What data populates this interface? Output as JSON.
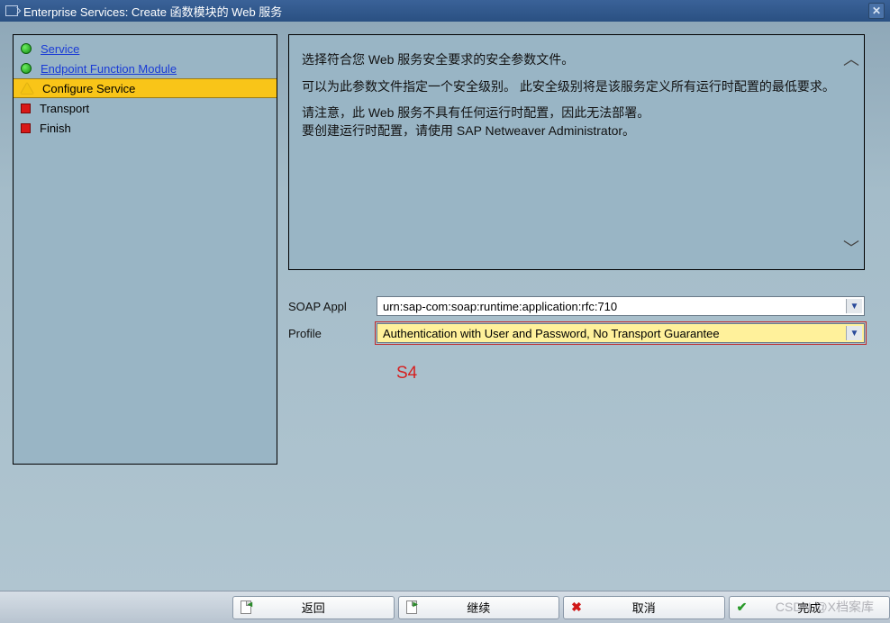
{
  "titlebar": {
    "title": "Enterprise Services: Create 函数模块的 Web 服务"
  },
  "steps": [
    {
      "label": "Service",
      "status": "done",
      "link": true
    },
    {
      "label": "Endpoint Function Module",
      "status": "done",
      "link": true
    },
    {
      "label": "Configure Service",
      "status": "current",
      "link": false
    },
    {
      "label": "Transport",
      "status": "todo",
      "link": false
    },
    {
      "label": "Finish",
      "status": "todo",
      "link": false
    }
  ],
  "description": {
    "p1": "选择符合您 Web 服务安全要求的安全参数文件。",
    "p2": "可以为此参数文件指定一个安全级别。 此安全级别将是该服务定义所有运行时配置的最低要求。",
    "p3": "请注意，此 Web 服务不具有任何运行时配置，因此无法部署。",
    "p4": "要创建运行时配置，请使用 SAP Netweaver Administrator。"
  },
  "form": {
    "soap_label": "SOAP Appl",
    "soap_value": "urn:sap-com:soap:runtime:application:rfc:710",
    "profile_label": "Profile",
    "profile_value": "Authentication with User and Password, No Transport Guarantee"
  },
  "annotation": "S4",
  "buttons": {
    "back": "返回",
    "continue": "继续",
    "cancel": "取消",
    "finish": "完成"
  },
  "watermark": "CSDN @X档案库"
}
